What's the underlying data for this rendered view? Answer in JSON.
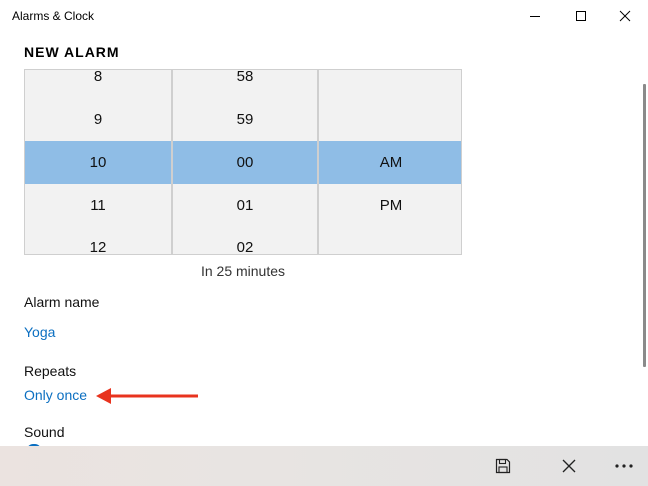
{
  "window": {
    "title": "Alarms & Clock"
  },
  "page": {
    "heading": "NEW ALARM"
  },
  "picker": {
    "hours": [
      "8",
      "9",
      "10",
      "11",
      "12"
    ],
    "minutes": [
      "58",
      "59",
      "00",
      "01",
      "02"
    ],
    "periods": [
      "AM",
      "PM"
    ],
    "selected": {
      "hour": "10",
      "minute": "00",
      "period": "AM"
    },
    "highlight_color": "#8fbde6"
  },
  "relative_time": "In 25 minutes",
  "alarm_name": {
    "label": "Alarm name",
    "value": "Yoga"
  },
  "repeats": {
    "label": "Repeats",
    "value": "Only once"
  },
  "sound": {
    "label": "Sound"
  },
  "colors": {
    "accent": "#0b6fc1",
    "annotation_arrow": "#e8331e"
  },
  "icons": {
    "minimize": "minimize-icon",
    "maximize": "maximize-icon",
    "close": "close-icon",
    "save": "save-icon",
    "discard": "close-icon",
    "more": "more-icon"
  }
}
